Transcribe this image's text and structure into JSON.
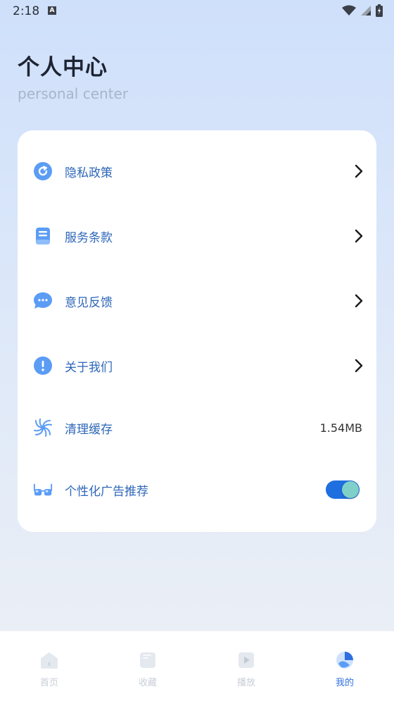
{
  "status": {
    "time": "2:18",
    "indicator": "A"
  },
  "header": {
    "title": "个人中心",
    "subtitle": "personal center"
  },
  "menu": [
    {
      "label": "隐私政策",
      "icon": "refresh-circle-icon",
      "trailing": "chevron"
    },
    {
      "label": "服务条款",
      "icon": "document-icon",
      "trailing": "chevron"
    },
    {
      "label": "意见反馈",
      "icon": "chat-bubble-icon",
      "trailing": "chevron"
    },
    {
      "label": "关于我们",
      "icon": "info-exclamation-icon",
      "trailing": "chevron"
    },
    {
      "label": "清理缓存",
      "icon": "swirl-icon",
      "trailing": "value",
      "value": "1.54MB"
    },
    {
      "label": "个性化广告推荐",
      "icon": "glasses-icon",
      "trailing": "toggle",
      "enabled": true
    }
  ],
  "tabs": [
    {
      "label": "首页",
      "icon": "home-icon",
      "active": false
    },
    {
      "label": "收藏",
      "icon": "bookmark-icon",
      "active": false
    },
    {
      "label": "播放",
      "icon": "play-icon",
      "active": false
    },
    {
      "label": "我的",
      "icon": "profile-icon",
      "active": true
    }
  ],
  "colors": {
    "accent": "#2f6fe0",
    "label": "#2e67b8",
    "icon": "#5b9cf5",
    "toggle_on": "#1f6fe0"
  }
}
